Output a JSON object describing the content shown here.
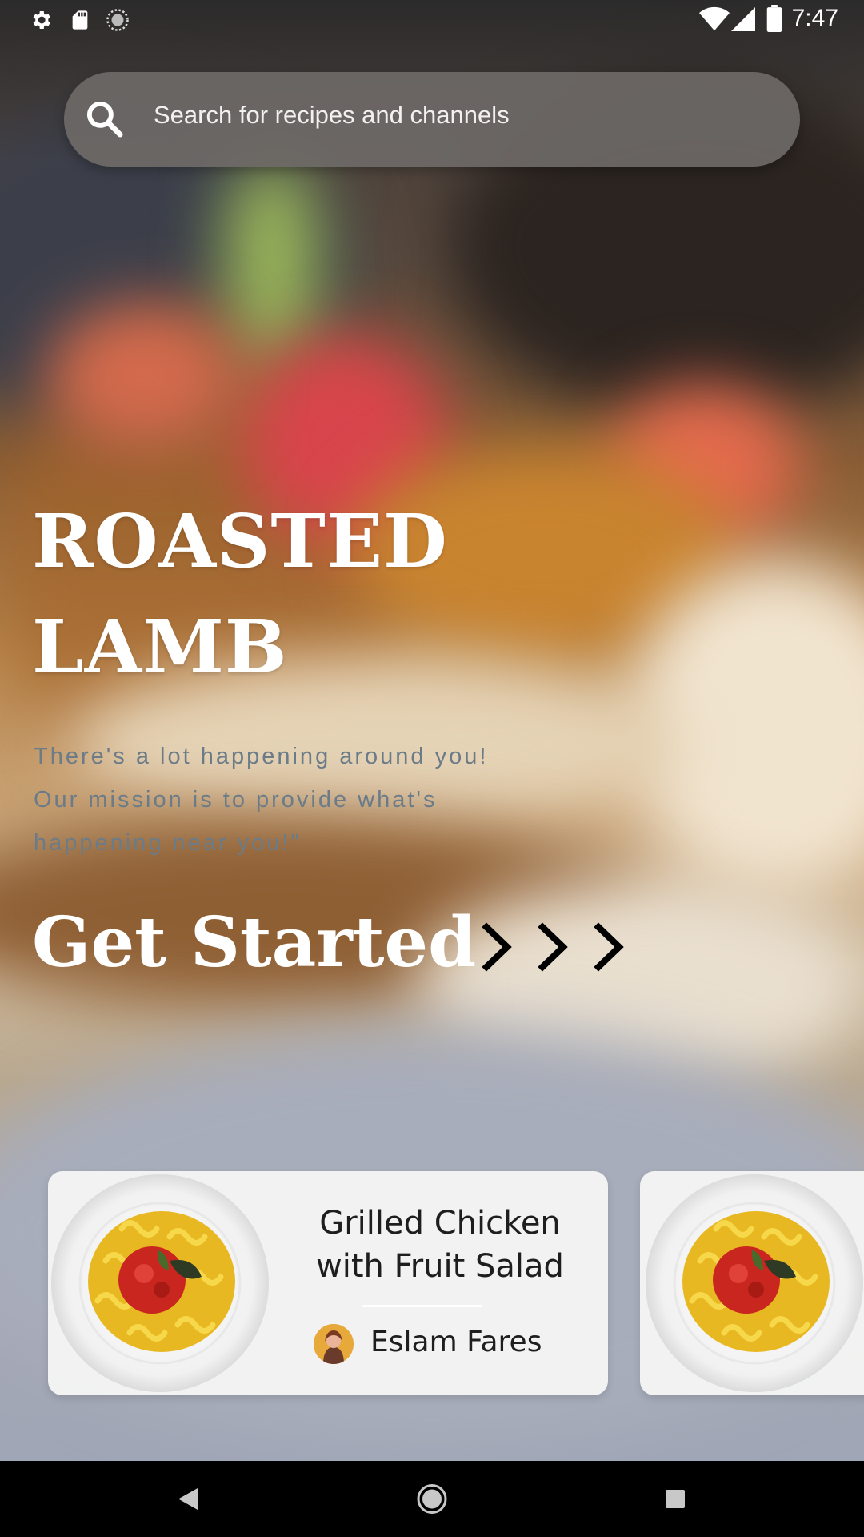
{
  "status_bar": {
    "time": "7:47",
    "left_icons": [
      "settings-icon",
      "sd-card-icon",
      "sync-icon"
    ],
    "right_icons": [
      "wifi-icon",
      "signal-icon",
      "battery-icon"
    ]
  },
  "search": {
    "placeholder": "Search for recipes and channels",
    "icon": "search-icon"
  },
  "hero": {
    "title_line1": "ROASTED",
    "title_line2": "LAMB",
    "tagline_line1": "There's a lot happening around you!",
    "tagline_line2": "Our mission is to provide what's",
    "tagline_line3": "happening near you!\"",
    "cta_label": "Get Started",
    "cta_icon": "triple-chevron-right-icon"
  },
  "cards": [
    {
      "title_line1": "Grilled Chicken",
      "title_line2": "with Fruit Salad",
      "author": "Eslam Fares"
    }
  ],
  "nav": {
    "buttons": [
      "back-icon",
      "home-icon",
      "recents-icon"
    ]
  },
  "colors": {
    "tagline": "#6b7c88",
    "search_bg": "#6e6967",
    "card_bg": "#f6f5f4"
  }
}
